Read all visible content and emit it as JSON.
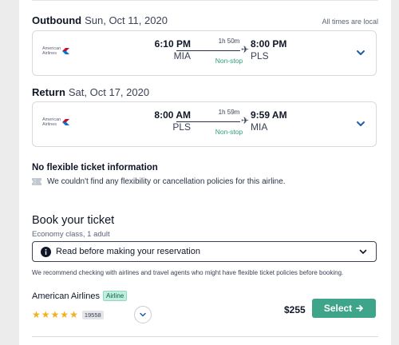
{
  "outbound": {
    "label": "Outbound",
    "date": "Sun, Oct 11, 2020",
    "note": "All times are local",
    "airline_logo_text": [
      "American",
      "Airlines"
    ],
    "depart_time": "6:10 PM",
    "depart_airport": "MIA",
    "duration": "1h 50m",
    "stops": "Non-stop",
    "arrive_time": "8:00 PM",
    "arrive_airport": "PLS"
  },
  "return": {
    "label": "Return",
    "date": "Sat, Oct 17, 2020",
    "airline_logo_text": [
      "American",
      "Airlines"
    ],
    "depart_time": "8:00 AM",
    "depart_airport": "PLS",
    "duration": "1h 59m",
    "stops": "Non-stop",
    "arrive_time": "9:59 AM",
    "arrive_airport": "MIA"
  },
  "flex": {
    "title": "No flexible ticket information",
    "message": "We couldn't find any flexibility or cancellation policies for this airline."
  },
  "booking": {
    "title": "Book your ticket",
    "subtitle": "Economy class, 1 adult",
    "reserve_label": "Read before making your reservation",
    "recommendation": "We recommend checking with airlines and travel agents who might have flexible ticket policies before booking.",
    "airline_name": "American Airlines",
    "airline_badge": "Airline",
    "rating_stars": 5,
    "review_count": "19558",
    "price": "$255",
    "select_label": "Select"
  },
  "colors": {
    "accent_green": "#3fa58a",
    "chevron_blue": "#1f5fa8",
    "star_gold": "#f2b01e"
  },
  "icons": {
    "plane": "plane-icon",
    "expand": "chevron-down-icon",
    "ticket": "ticket-icon",
    "info": "info-icon",
    "arrow": "arrow-right-icon"
  }
}
